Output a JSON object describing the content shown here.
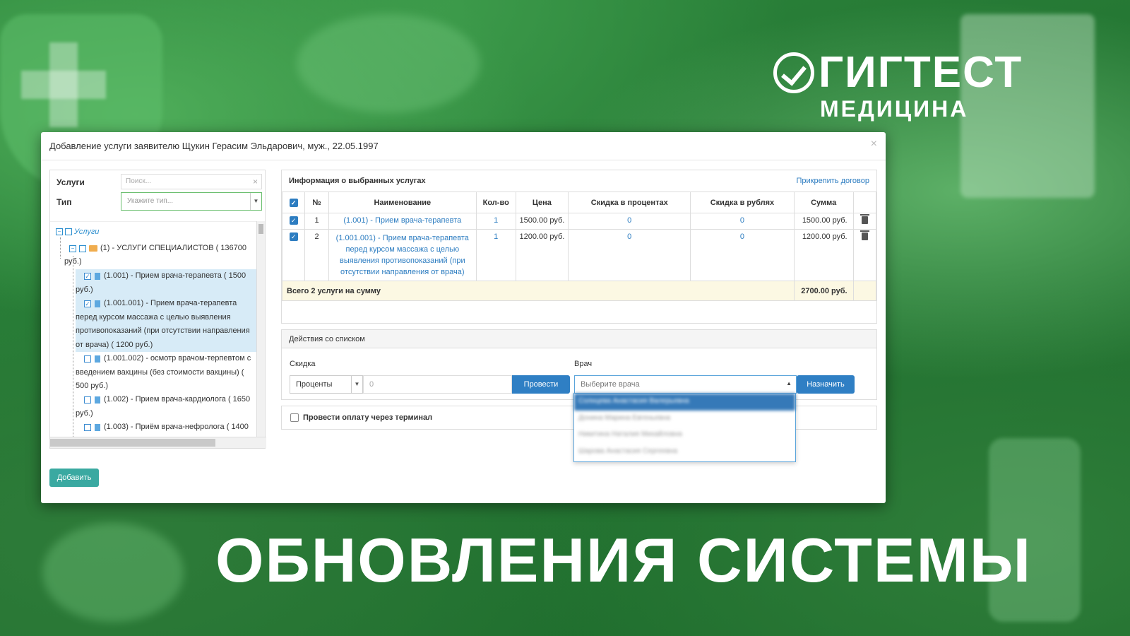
{
  "logo": {
    "title": "ГИГТЕСТ",
    "subtitle": "МЕДИЦИНА"
  },
  "headline": "ОБНОВЛЕНИЯ СИСТЕМЫ",
  "colors": {
    "background": "#2a8238",
    "accent_blue": "#2f7fc4",
    "add_button": "#3aa9a1",
    "total_row": "#fcf8e3"
  },
  "modal": {
    "title": "Добавление услуги заявителю Щукин Герасим Эльдарович, муж., 22.05.1997",
    "close": "×",
    "add_button": "Добавить"
  },
  "left": {
    "services_label": "Услуги",
    "search_placeholder": "Поиск...",
    "search_clear": "×",
    "type_label": "Тип",
    "type_placeholder": "Укажите тип...",
    "tree": {
      "root": "Услуги",
      "category": "(1) - УСЛУГИ СПЕЦИАЛИСТОВ ( 136700",
      "category_cont": "руб.)",
      "items": [
        {
          "lines": [
            "(1.001) - Прием врача-терапевта ( 1500",
            "руб.)"
          ],
          "checked": true
        },
        {
          "lines": [
            "(1.001.001) - Прием врача-терапевта",
            "перед курсом массажа с целью выявления",
            "противопоказаний (при отсутствии направления",
            "от врача) ( 1200 руб.)"
          ],
          "checked": true
        },
        {
          "lines": [
            "(1.001.002) - осмотр врачом-терпевтом с",
            "введением вакцины (без стоимости вакцины) (",
            "500 руб.)"
          ],
          "checked": false
        },
        {
          "lines": [
            "(1.002) - Прием врача-кардиолога ( 1650",
            "руб.)"
          ],
          "checked": false
        },
        {
          "lines": [
            "(1.003) - Приём врача-нефролога ( 1400"
          ],
          "checked": false
        }
      ]
    }
  },
  "selected": {
    "title": "Информация о выбранных услугах",
    "attach_link": "Прикрепить договор",
    "columns": [
      "№",
      "Наименование",
      "Кол-во",
      "Цена",
      "Скидка в процентах",
      "Скидка в рублях",
      "Сумма"
    ],
    "rows": [
      {
        "num": "1",
        "name": "(1.001) - Прием врача-терапевта",
        "qty": "1",
        "price": "1500.00 руб.",
        "disc_pct": "0",
        "disc_rub": "0",
        "sum": "1500.00 руб."
      },
      {
        "num": "2",
        "name": "(1.001.001) - Прием врача-терапевта перед курсом массажа с целью выявления противопоказаний (при отсутствии направления от врача)",
        "qty": "1",
        "price": "1200.00 руб.",
        "disc_pct": "0",
        "disc_rub": "0",
        "sum": "1200.00 руб."
      }
    ],
    "total_label": "Всего 2 услуги на сумму",
    "total_value": "2700.00 руб."
  },
  "actions": {
    "title": "Действия со списком",
    "discount_label": "Скидка",
    "discount_type": "Проценты",
    "discount_value": "0",
    "apply_button": "Провести",
    "doctor_label": "Врач",
    "doctor_placeholder": "Выберите врача",
    "assign_button": "Назначить",
    "doctor_options": [
      "Солнцевa Анастасия Валерьевна",
      "Донина Марина Евгеньевна",
      "Никитина Наталия Михайловна",
      "Шарова Анастасия Сергеевна"
    ]
  },
  "terminal_label": "Провести оплату через терминал"
}
